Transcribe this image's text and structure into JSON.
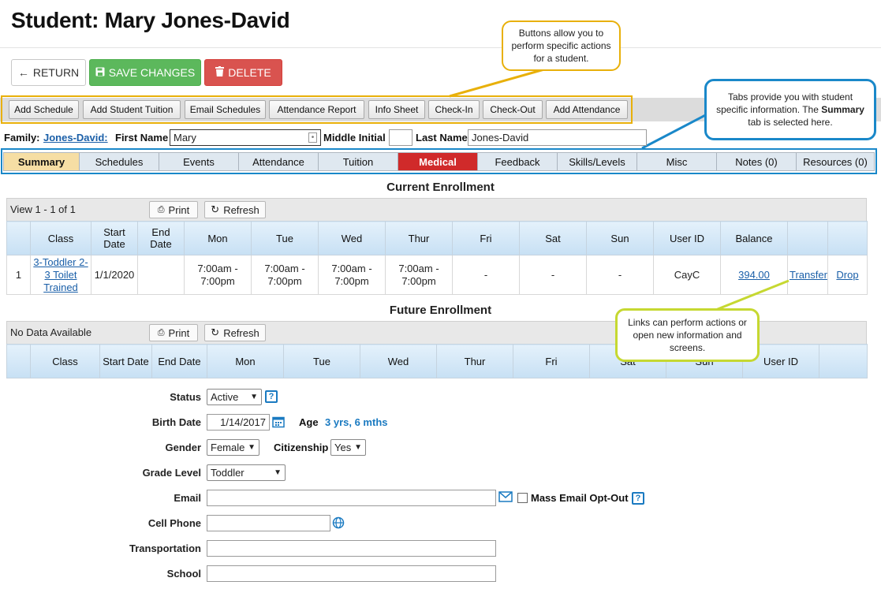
{
  "page": {
    "title": "Student: Mary Jones-David"
  },
  "actions": {
    "return_label": "RETURN",
    "save_label": "SAVE CHANGES",
    "delete_label": "DELETE"
  },
  "toolbar": [
    "Add Schedule",
    "Add Student Tuition",
    "Email Schedules",
    "Attendance Report",
    "Info Sheet",
    "Check-In",
    "Check-Out",
    "Add Attendance"
  ],
  "callouts": {
    "buttons": "Buttons allow you to perform specific actions for a student.",
    "tabs_prefix": "Tabs provide you with student specific information. The ",
    "tabs_bold": "Summary",
    "tabs_suffix": " tab is selected here.",
    "links": "Links can perform actions or open new information and screens."
  },
  "student": {
    "family_label": "Family:",
    "family": "Jones-David:",
    "first_name_label": "First Name",
    "first_name": "Mary",
    "middle_initial_label": "Middle Initial",
    "middle_initial": "",
    "last_name_label": "Last Name",
    "last_name": "Jones-David"
  },
  "tabs": [
    "Summary",
    "Schedules",
    "Events",
    "Attendance",
    "Tuition",
    "Medical",
    "Feedback",
    "Skills/Levels",
    "Misc",
    "Notes (0)",
    "Resources (0)"
  ],
  "current_enrollment": {
    "title": "Current Enrollment",
    "view": "View 1 - 1 of 1",
    "print": "Print",
    "refresh": "Refresh",
    "columns": [
      "",
      "Class",
      "Start Date",
      "End Date",
      "Mon",
      "Tue",
      "Wed",
      "Thur",
      "Fri",
      "Sat",
      "Sun",
      "User ID",
      "Balance",
      "",
      ""
    ],
    "rows": [
      {
        "num": "1",
        "class": "3-Toddler 2-3 Toilet Trained",
        "start": "1/1/2020",
        "end": "",
        "mon": "7:00am - 7:00pm",
        "tue": "7:00am - 7:00pm",
        "wed": "7:00am - 7:00pm",
        "thur": "7:00am - 7:00pm",
        "fri": "-",
        "sat": "-",
        "sun": "-",
        "user_id": "CayC",
        "balance": "394.00",
        "transfer": "Transfer",
        "drop": "Drop"
      }
    ]
  },
  "future_enrollment": {
    "title": "Future Enrollment",
    "view": "No Data Available",
    "print": "Print",
    "refresh": "Refresh",
    "columns": [
      "",
      "Class",
      "Start Date",
      "End Date",
      "Mon",
      "Tue",
      "Wed",
      "Thur",
      "Fri",
      "Sat",
      "Sun",
      "User ID",
      ""
    ]
  },
  "form": {
    "status_label": "Status",
    "status": "Active",
    "birth_date_label": "Birth Date",
    "birth_date": "1/14/2017",
    "age_label": "Age",
    "age": "3 yrs, 6 mths",
    "gender_label": "Gender",
    "gender": "Female",
    "citizenship_label": "Citizenship",
    "citizenship": "Yes",
    "grade_label": "Grade Level",
    "grade": "Toddler",
    "email_label": "Email",
    "email": "",
    "mass_email_label": "Mass Email Opt-Out",
    "cell_label": "Cell Phone",
    "cell": "",
    "transportation_label": "Transportation",
    "transportation": "",
    "school_label": "School",
    "school": ""
  },
  "colors": {
    "accent": "#1a88c9",
    "save": "#5cb85c",
    "delete": "#d9534f",
    "medical_tab": "#d02a2a",
    "selected_tab": "#f6dea4"
  }
}
